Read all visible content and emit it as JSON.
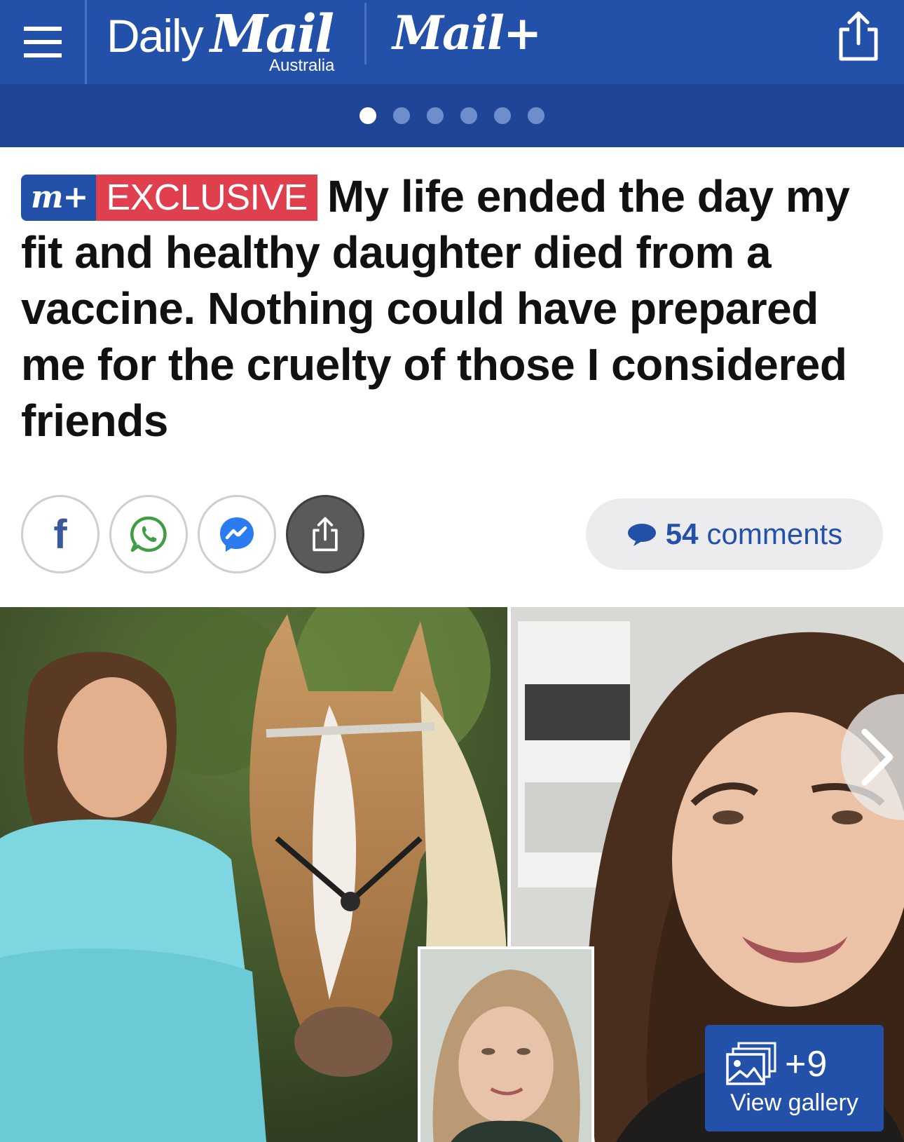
{
  "header": {
    "brand_daily": "Daily",
    "brand_mail": "Mail",
    "brand_region": "Australia",
    "mailplus": "Mail+",
    "accent": "#2350a8"
  },
  "carousel": {
    "dot_count": 6,
    "active_index": 0
  },
  "article": {
    "badge_logo": "m+",
    "badge_label": "EXCLUSIVE",
    "headline": "My life ended the day my fit and healthy daughter died from a vaccine. Nothing could have prepared me for the cruelty of those I considered friends"
  },
  "share": {
    "buttons": [
      "facebook-icon",
      "whatsapp-icon",
      "messenger-icon",
      "share-icon"
    ],
    "comments_count": "54",
    "comments_label": "comments"
  },
  "gallery": {
    "count": "+9",
    "label": "View gallery"
  }
}
